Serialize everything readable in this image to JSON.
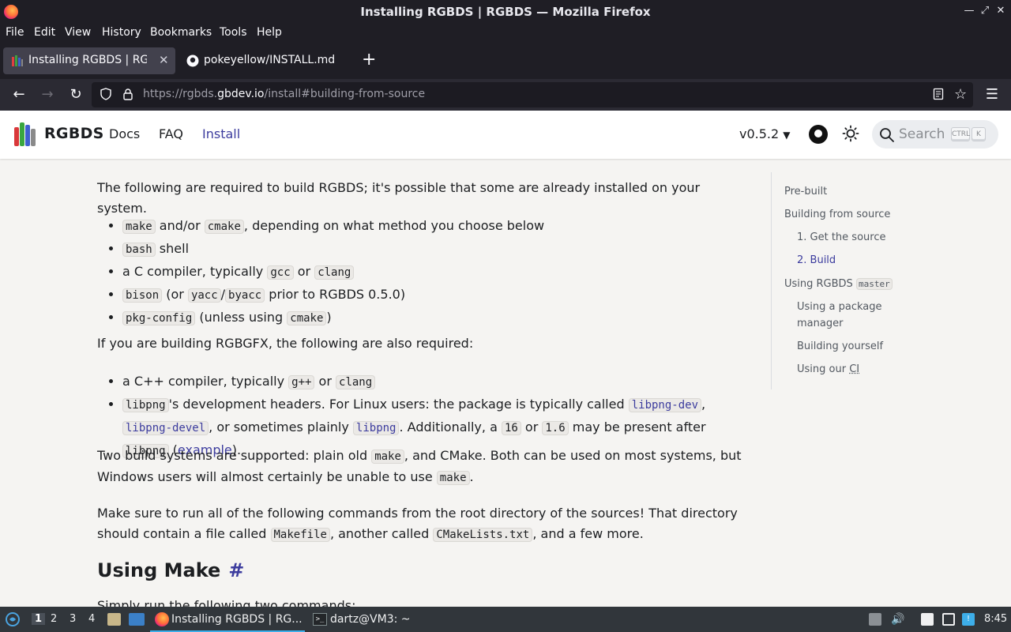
{
  "window": {
    "title": "Installing RGBDS | RGBDS — Mozilla Firefox"
  },
  "menu": [
    "File",
    "Edit",
    "View",
    "History",
    "Bookmarks",
    "Tools",
    "Help"
  ],
  "tabs": [
    {
      "label": "Installing RGBDS | RGBDS",
      "active": true
    },
    {
      "label": "pokeyellow/INSTALL.md at",
      "active": false
    }
  ],
  "url": {
    "prefix": "https://rgbds.",
    "domain": "gbdev.io",
    "path": "/install#building-from-source"
  },
  "site": {
    "brand": "RGBDS",
    "nav": [
      "Docs",
      "FAQ",
      "Install"
    ],
    "active_nav": "Install",
    "version": "v0.5.2",
    "search_placeholder": "Search",
    "key_ctrl": "CTRL",
    "key_k": "K"
  },
  "content": {
    "p1": "The following are required to build RGBDS; it's possible that some are already installed on your system.",
    "req": {
      "li1_code1": "make",
      "li1_mid": " and/or ",
      "li1_code2": "cmake",
      "li1_end": ", depending on what method you choose below",
      "li2_code": "bash",
      "li2_end": " shell",
      "li3_start": "a C compiler, typically ",
      "li3_code1": "gcc",
      "li3_mid": " or ",
      "li3_code2": "clang",
      "li4_code1": "bison",
      "li4_mid": " (or ",
      "li4_code2": "yacc",
      "li4_slash": "/",
      "li4_code3": "byacc",
      "li4_end": " prior to RGBDS 0.5.0)",
      "li5_code1": "pkg-config",
      "li5_mid": " (unless using ",
      "li5_code2": "cmake",
      "li5_end": ")"
    },
    "p2": "If you are building RGBGFX, the following are also required:",
    "gfx": {
      "li1_start": "a C++ compiler, typically ",
      "li1_code1": "g++",
      "li1_mid": " or ",
      "li1_code2": "clang",
      "li2_code1": "libpng",
      "li2_t1": "'s development headers. For Linux users: the package is typically called ",
      "li2_code2": "libpng-dev",
      "li2_comma": ", ",
      "li2_code3": "libpng-devel",
      "li2_t2": ", or sometimes plainly ",
      "li2_code4": "libpng",
      "li2_t3": ". Additionally, a ",
      "li2_code5": "16",
      "li2_t4": " or ",
      "li2_code6": "1.6",
      "li2_t5": " may be present after ",
      "li2_code7": "libpng",
      "li2_t6": " (",
      "li2_link": "example",
      "li2_t7": ")."
    },
    "p3": {
      "t1": "Two build systems are supported: plain old ",
      "c1": "make",
      "t2": ", and CMake. Both can be used on most systems, but Windows users will almost certainly be unable to use ",
      "c2": "make",
      "t3": "."
    },
    "p4": {
      "t1": "Make sure to run all of the following commands from the root directory of the sources! That directory should contain a file called ",
      "c1": "Makefile",
      "t2": ", another called ",
      "c2": "CMakeLists.txt",
      "t3": ", and a few more."
    },
    "h2": "Using Make",
    "h2_hash": "#",
    "p5": "Simply run the following two commands:"
  },
  "toc": {
    "prebuilt": "Pre-built",
    "from_source": "Building from source",
    "get_source": "1. Get the source",
    "build": "2. Build",
    "using_rgbds": "Using RGBDS ",
    "using_rgbds_code": "master",
    "pkg_manager_1": "Using a package",
    "pkg_manager_2": "manager",
    "yourself": "Building yourself",
    "ci_1": "Using our ",
    "ci_2": "CI"
  },
  "taskbar": {
    "workspaces": [
      "1",
      "2",
      "3",
      "4"
    ],
    "task_firefox": "Installing RGBDS | RG...",
    "task_terminal": "dartz@VM3: ~",
    "clock": "8:45"
  },
  "colors": {
    "accent": "#3c3c9e",
    "page_bg": "#f5f4f2",
    "firefox_chrome": "#1f1e25"
  }
}
